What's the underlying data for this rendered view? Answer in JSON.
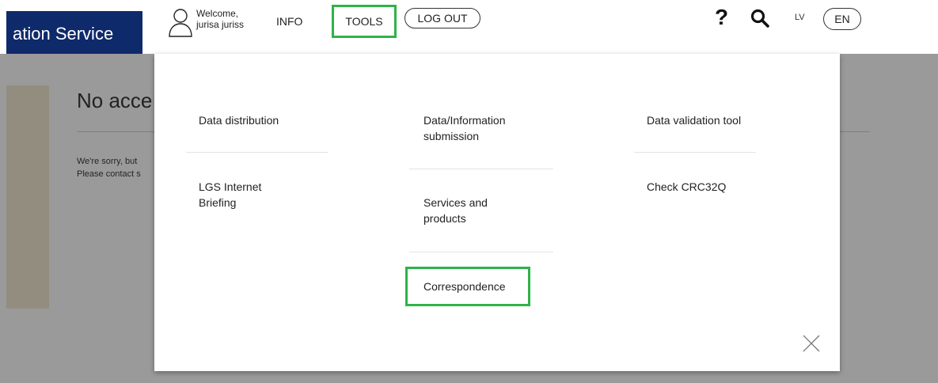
{
  "header": {
    "brand_title": "ation Service",
    "welcome": "Welcome,",
    "username": "jurisa juriss",
    "nav_info": "INFO",
    "nav_tools": "TOOLS",
    "nav_logout": "LOG OUT",
    "help": "?",
    "lang_lv": "LV",
    "lang_en": "EN"
  },
  "page": {
    "heading": "No acce",
    "text_line1": "We're sorry, but",
    "text_line2": "Please contact s"
  },
  "tools_menu": {
    "col1": [
      "Data distribution",
      "LGS Internet Briefing"
    ],
    "col2": [
      "Data/Information submission",
      "Services and products",
      "Correspondence"
    ],
    "col3": [
      "Data validation tool",
      "Check CRC32Q"
    ]
  },
  "colors": {
    "brand": "#0f2a6b",
    "highlight": "#2eb348",
    "overlay": "#9a9a9a"
  }
}
